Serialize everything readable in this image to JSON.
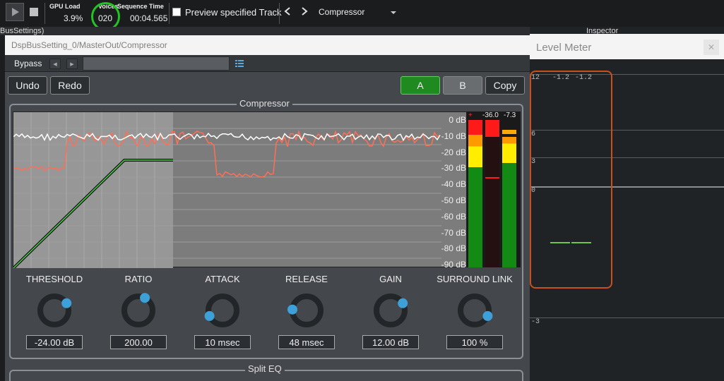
{
  "toolbar": {
    "gpu_load_label": "GPU Load",
    "gpu_load_value": "3.9%",
    "voices_label": "Voices",
    "voices_value": "020",
    "seq_time_label": "Sequence Time",
    "seq_time_value": "00:04.565",
    "preview_label": "Preview specified Track",
    "track_name": "Compressor"
  },
  "strip": {
    "bus_settings": "BusSettings)",
    "inspector": "Inspector"
  },
  "panel": {
    "path": "DspBusSetting_0/MasterOut/Compressor",
    "bypass_label": "Bypass",
    "undo": "Undo",
    "redo": "Redo",
    "a": "A",
    "b": "B",
    "copy": "Copy",
    "compressor_title": "Compressor",
    "split_eq_title": "Split EQ"
  },
  "graph": {
    "db_labels": [
      "0 dB",
      "-10 dB",
      "-20 dB",
      "-30 dB",
      "-40 dB",
      "-50 dB",
      "-60 dB",
      "-70 dB",
      "-80 dB",
      "-90 dB"
    ],
    "meter_readout_1": "-36.0",
    "meter_readout_2": "-7.3"
  },
  "knobs": [
    {
      "label": "THRESHOLD",
      "value": "-24.00 dB",
      "level": 0.72
    },
    {
      "label": "RATIO",
      "value": "200.00",
      "level": 0.6
    },
    {
      "label": "ATTACK",
      "value": "10 msec",
      "level": 0.08
    },
    {
      "label": "RELEASE",
      "value": "48 msec",
      "level": 0.18
    },
    {
      "label": "GAIN",
      "value": "12.00 dB",
      "level": 0.72
    },
    {
      "label": "SURROUND LINK",
      "value": "100 %",
      "level": 0.92
    }
  ],
  "level_meter": {
    "title": "Level Meter",
    "readout_1": "-1.2",
    "readout_2": "-1.2",
    "ticks": [
      "12",
      "6",
      "3",
      "0",
      "-3"
    ]
  },
  "colors": {
    "accent_green": "#1f8a1f",
    "curve_red": "#ff6f55",
    "meter_orange": "#cc5522",
    "knob_blue": "#3ea0d8"
  }
}
